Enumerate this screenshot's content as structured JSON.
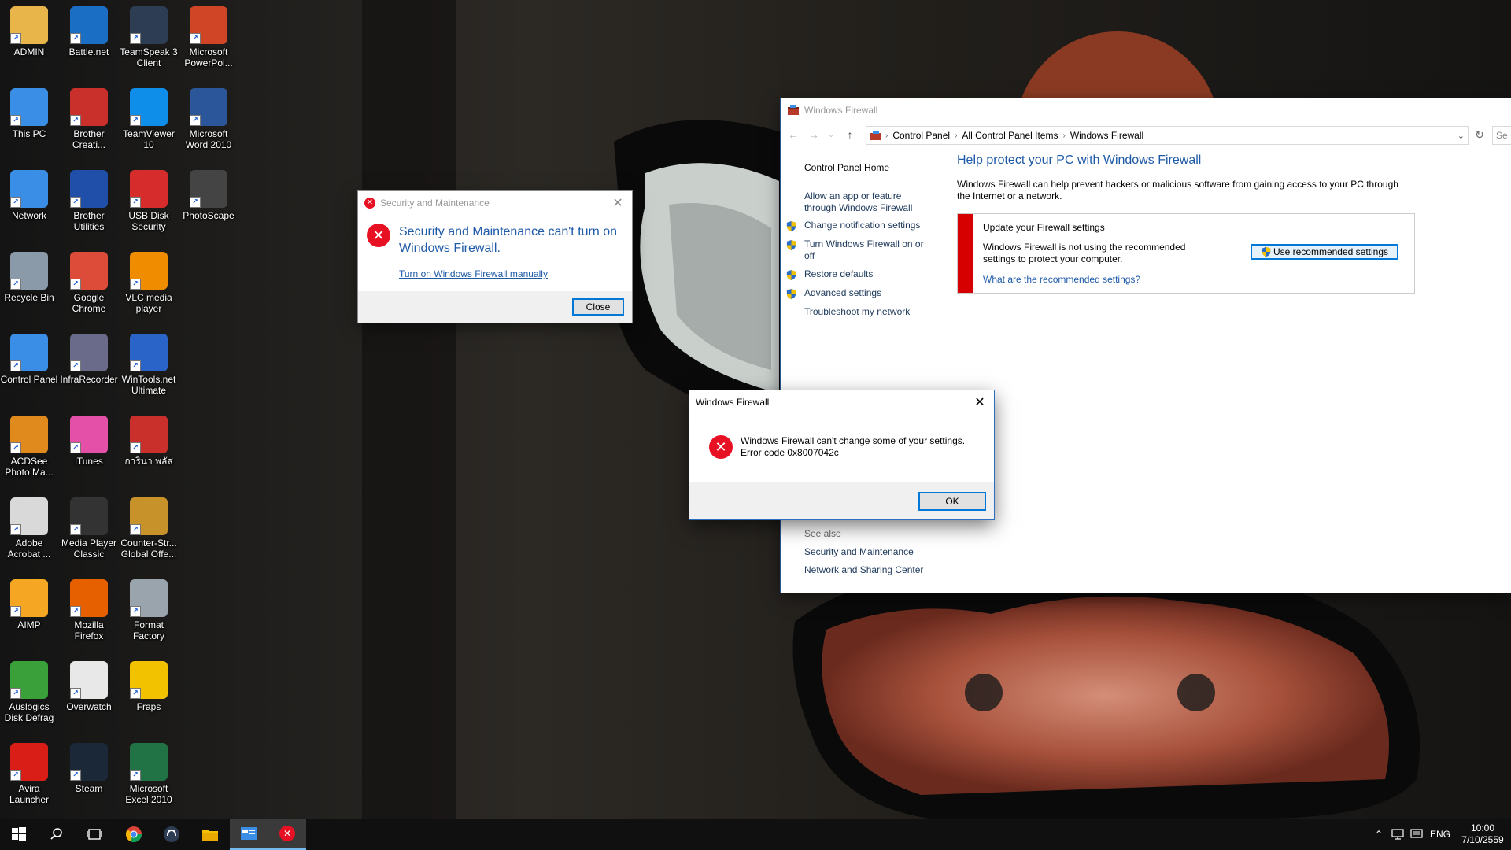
{
  "desktop": {
    "icons": [
      {
        "label": "ADMIN",
        "icon": "user-folder-icon",
        "color": "#e8b54a"
      },
      {
        "label": "Battle.net",
        "icon": "battlenet-icon",
        "color": "#1a6fc4"
      },
      {
        "label": "TeamSpeak 3 Client",
        "icon": "teamspeak-icon",
        "color": "#2d3d54"
      },
      {
        "label": "Microsoft PowerPoi...",
        "icon": "powerpoint-icon",
        "color": "#d04525"
      },
      {
        "label": "This PC",
        "icon": "computer-icon",
        "color": "#3a8ee6"
      },
      {
        "label": "Brother Creati...",
        "icon": "brother-creative-icon",
        "color": "#c9302c"
      },
      {
        "label": "TeamViewer 10",
        "icon": "teamviewer-icon",
        "color": "#0e8ee9"
      },
      {
        "label": "Microsoft Word 2010",
        "icon": "word-icon",
        "color": "#2b579a"
      },
      {
        "label": "Network",
        "icon": "network-icon",
        "color": "#3a8ee6"
      },
      {
        "label": "Brother Utilities",
        "icon": "brother-utilities-icon",
        "color": "#1f4fa8"
      },
      {
        "label": "USB Disk Security",
        "icon": "usb-security-icon",
        "color": "#d62c2c"
      },
      {
        "label": "PhotoScape",
        "icon": "photoscape-icon",
        "color": "#444444"
      },
      {
        "label": "Recycle Bin",
        "icon": "recycle-bin-icon",
        "color": "#8a9aa8"
      },
      {
        "label": "Google Chrome",
        "icon": "chrome-icon",
        "color": "#dd4b39"
      },
      {
        "label": "VLC media player",
        "icon": "vlc-icon",
        "color": "#f08c00"
      },
      {
        "label": "Control Panel",
        "icon": "control-panel-icon",
        "color": "#3a8ee6"
      },
      {
        "label": "InfraRecorder",
        "icon": "infrarecorder-icon",
        "color": "#6a6a8a"
      },
      {
        "label": "WinTools.net Ultimate",
        "icon": "wintools-icon",
        "color": "#2a64c8"
      },
      {
        "label": "ACDSee Photo Ma...",
        "icon": "acdsee-icon",
        "color": "#e08a1e"
      },
      {
        "label": "iTunes",
        "icon": "itunes-icon",
        "color": "#e44fa8"
      },
      {
        "label": "การินา พลัส",
        "icon": "garena-icon",
        "color": "#c9302c"
      },
      {
        "label": "Adobe Acrobat ...",
        "icon": "acrobat-icon",
        "color": "#d9d9d9"
      },
      {
        "label": "Media Player Classic",
        "icon": "mpc-icon",
        "color": "#333333"
      },
      {
        "label": "Counter-Str... Global Offe...",
        "icon": "csgo-icon",
        "color": "#c8922a"
      },
      {
        "label": "AIMP",
        "icon": "aimp-icon",
        "color": "#f5a623"
      },
      {
        "label": "Mozilla Firefox",
        "icon": "firefox-icon",
        "color": "#e66000"
      },
      {
        "label": "Format Factory",
        "icon": "format-factory-icon",
        "color": "#9aa4ad"
      },
      {
        "label": "Auslogics Disk Defrag",
        "icon": "auslogics-icon",
        "color": "#3aa03a"
      },
      {
        "label": "Overwatch",
        "icon": "overwatch-icon",
        "color": "#e8e8e8"
      },
      {
        "label": "Fraps",
        "icon": "fraps-icon",
        "color": "#f2c200"
      },
      {
        "label": "Avira Launcher",
        "icon": "avira-icon",
        "color": "#d91e18"
      },
      {
        "label": "Steam",
        "icon": "steam-icon",
        "color": "#1b2838"
      },
      {
        "label": "Microsoft Excel 2010",
        "icon": "excel-icon",
        "color": "#217346"
      }
    ]
  },
  "firewall_window": {
    "title": "Windows Firewall",
    "breadcrumbs": [
      "Control Panel",
      "All Control Panel Items",
      "Windows Firewall"
    ],
    "search_placeholder": "Se",
    "left_nav": {
      "home": "Control Panel Home",
      "allow_app": "Allow an app or feature through Windows Firewall",
      "notification": "Change notification settings",
      "turn_on_off": "Turn Windows Firewall on or off",
      "restore": "Restore defaults",
      "advanced": "Advanced settings",
      "troubleshoot": "Troubleshoot my network",
      "see_also": "See also",
      "security_maint": "Security and Maintenance",
      "network_sharing": "Network and Sharing Center"
    },
    "heading": "Help protect your PC with Windows Firewall",
    "description": "Windows Firewall can help prevent hackers or malicious software from gaining access to your PC through the Internet or a network.",
    "alert": {
      "title": "Update your Firewall settings",
      "body": "Windows Firewall is not using the recommended settings to protect your computer.",
      "link": "What are the recommended settings?",
      "button": "Use recommended settings"
    }
  },
  "sm_dialog": {
    "title": "Security and Maintenance",
    "message": "Security and Maintenance can't turn on Windows Firewall.",
    "link": "Turn on Windows Firewall manually",
    "close_button": "Close"
  },
  "error_dialog": {
    "title": "Windows Firewall",
    "message_line1": "Windows Firewall can't change some of your settings.",
    "message_line2": "Error code 0x8007042c",
    "ok_button": "OK"
  },
  "taskbar": {
    "language": "ENG",
    "time": "10:00",
    "date": "7/10/2559"
  },
  "colors": {
    "accent": "#0078d7",
    "link": "#1e5aa8",
    "error_red": "#e81123",
    "alert_red": "#d70000"
  }
}
